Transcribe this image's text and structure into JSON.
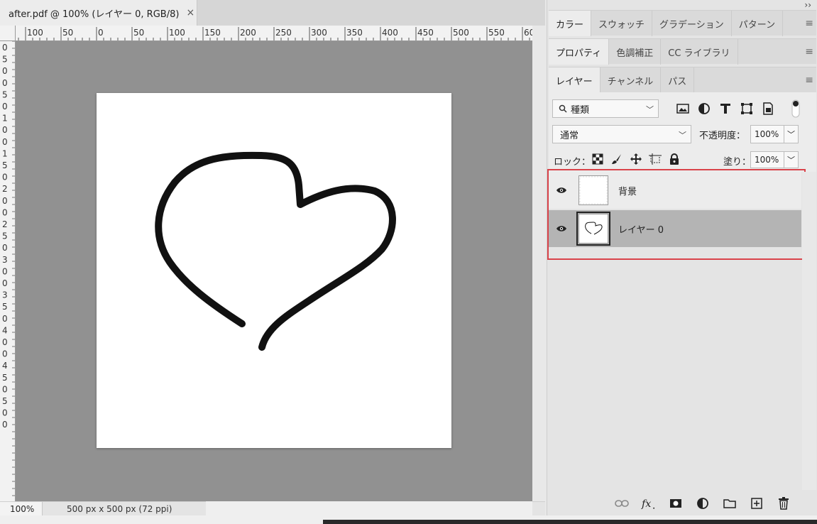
{
  "document": {
    "tab_title": "after.pdf @ 100% (レイヤー 0, RGB/8)",
    "close_glyph": "×",
    "ruler_top_labels": [
      "100",
      "50",
      "0",
      "50",
      "100",
      "150",
      "200",
      "250",
      "300",
      "350",
      "400",
      "450",
      "500",
      "550",
      "60"
    ],
    "ruler_left_labels": [
      "0",
      "5",
      "0",
      "0",
      "5",
      "0",
      "1",
      "0",
      "0",
      "1",
      "5",
      "0",
      "2",
      "0",
      "0",
      "2",
      "5",
      "0",
      "3",
      "0",
      "0",
      "3",
      "5",
      "0",
      "4",
      "0",
      "0",
      "4",
      "5",
      "0",
      "5",
      "0",
      "0"
    ],
    "zoom": "100%",
    "doc_info": "500 px x 500 px (72 ppi)",
    "status_arrow": "〉"
  },
  "panels": {
    "collapse": "››",
    "group1_tabs": [
      "カラー",
      "スウォッチ",
      "グラデーション",
      "パターン"
    ],
    "group2_tabs": [
      "プロパティ",
      "色調補正",
      "CC ライブラリ"
    ],
    "group3_tabs": [
      "レイヤー",
      "チャンネル",
      "パス"
    ],
    "menu_glyph": "≡"
  },
  "layers_panel": {
    "kind_filter": "種類",
    "blend_mode": "通常",
    "opacity_label": "不透明度：",
    "opacity_value": "100%",
    "lock_label": "ロック：",
    "fill_label": "塗り：",
    "fill_value": "100%",
    "layers": [
      {
        "name": "背景",
        "visible": true,
        "selected": false
      },
      {
        "name": "レイヤー 0",
        "visible": true,
        "selected": true
      }
    ],
    "icons": {
      "filter": [
        "image-filter-icon",
        "adjustment-filter-icon",
        "type-filter-icon",
        "shape-filter-icon",
        "smart-object-filter-icon"
      ],
      "lock": [
        "lock-transparent-icon",
        "lock-image-icon",
        "lock-position-icon",
        "lock-artboard-icon",
        "lock-all-icon"
      ],
      "footer": [
        "link-layers-icon",
        "fx-icon",
        "add-mask-icon",
        "new-adjustment-icon",
        "new-group-icon",
        "new-layer-icon",
        "delete-layer-icon"
      ]
    }
  },
  "colors": {
    "canvas_bg": "#919191",
    "selected_layer": "#b4b4b4",
    "highlight": "#d9434a"
  }
}
